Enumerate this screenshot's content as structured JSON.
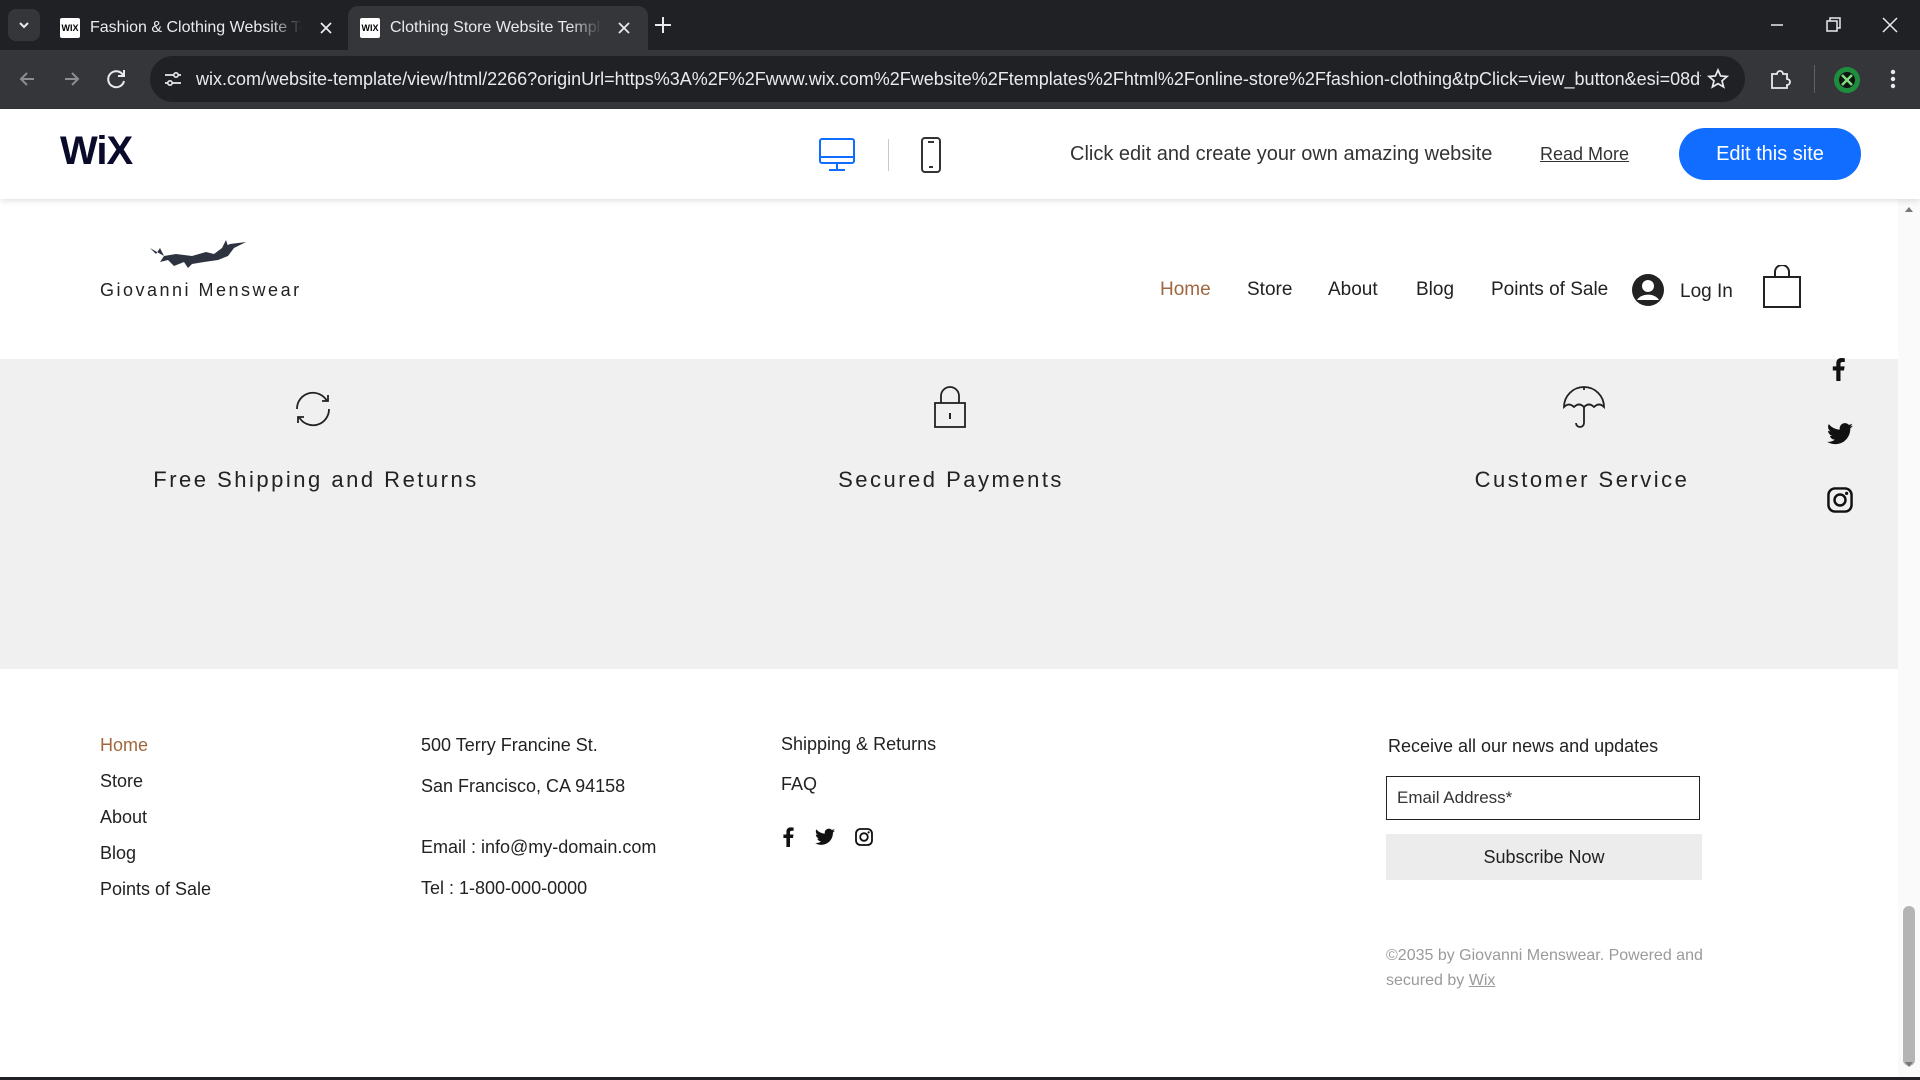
{
  "browser": {
    "tabs": [
      {
        "title": "Fashion & Clothing Website Templates",
        "favicon": "WIX",
        "active": false
      },
      {
        "title": "Clothing Store Website Template",
        "favicon": "WIX",
        "active": true
      }
    ],
    "url": "wix.com/website-template/view/html/2266?originUrl=https%3A%2F%2Fwww.wix.com%2Fwebsite%2Ftemplates%2Fhtml%2Fonline-store%2Ffashion-clothing&tpClick=view_button&esi=08dfffd..."
  },
  "wixbar": {
    "logo": "WiX",
    "promo": "Click edit and create your own amazing website",
    "read_more": "Read More",
    "edit_button": "Edit this site"
  },
  "site": {
    "brand": "Giovanni Menswear",
    "nav": [
      "Home",
      "Store",
      "About",
      "Blog",
      "Points of Sale"
    ],
    "login": "Log In",
    "features": [
      {
        "icon": "refresh-icon",
        "title": "Free Shipping and Returns"
      },
      {
        "icon": "lock-icon",
        "title": "Secured Payments"
      },
      {
        "icon": "umbrella-icon",
        "title": "Customer Service"
      }
    ],
    "footer": {
      "nav": [
        "Home",
        "Store",
        "About",
        "Blog",
        "Points of Sale"
      ],
      "address_line1": "500 Terry Francine St.",
      "address_line2": "San Francisco, CA 94158",
      "email": "Email : info@my-domain.com",
      "tel": "Tel : 1-800-000-0000",
      "links": [
        "Shipping & Returns",
        "FAQ"
      ],
      "newsletter_title": "Receive all our news and updates",
      "email_placeholder": "Email Address*",
      "subscribe": "Subscribe Now",
      "copyright": "©2035 by Giovanni Menswear. Powered and secured by",
      "copyright_link": "Wix"
    }
  },
  "colors": {
    "accent_link": "#a0673e",
    "wix_blue": "#116dff",
    "feature_bg": "#f0f0f0"
  }
}
